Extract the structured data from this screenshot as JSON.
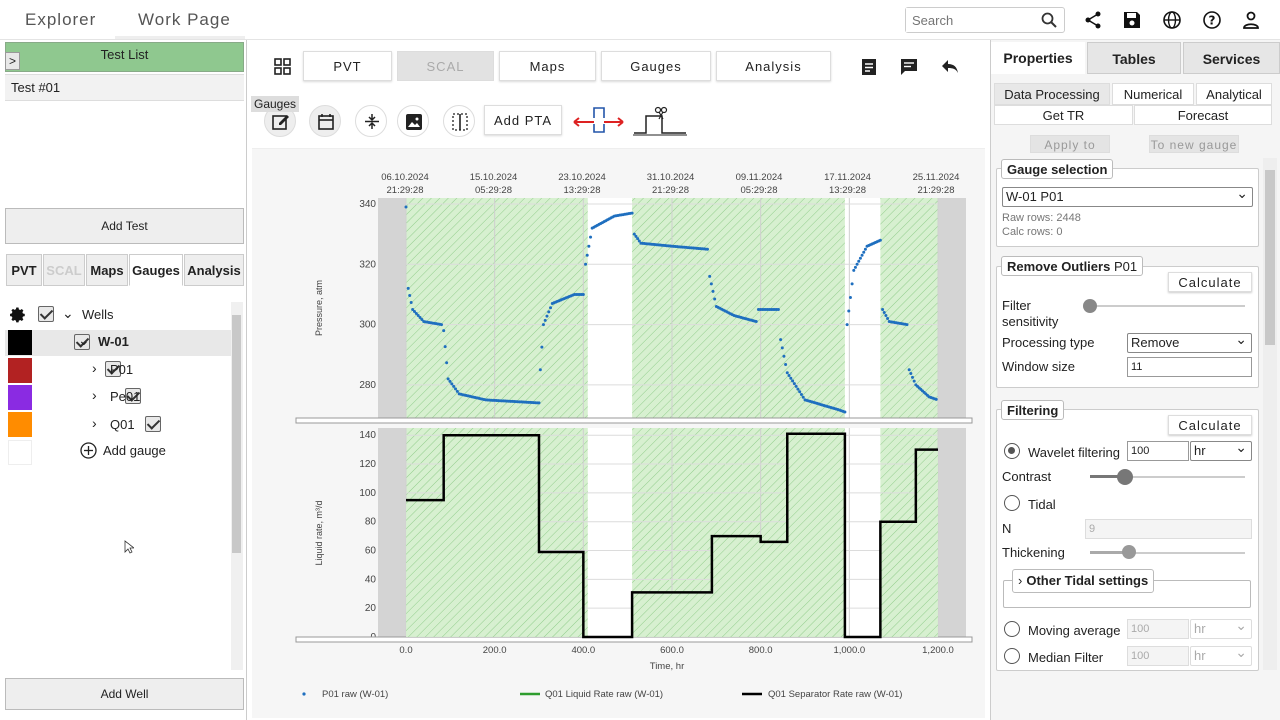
{
  "nav": {
    "explorer": "Explorer",
    "work_page": "Work Page"
  },
  "search": {
    "placeholder": "Search"
  },
  "top_icons": [
    "share-icon",
    "save-icon",
    "globe-icon",
    "help-icon",
    "user-icon"
  ],
  "left": {
    "test_list_header": "Test List",
    "collapse": ">",
    "test_item": "Test #01",
    "add_test": "Add Test",
    "tabs": [
      "PVT",
      "SCAL",
      "Maps",
      "Gauges",
      "Analysis"
    ],
    "tree": {
      "wells_label": "Wells",
      "well": "W-01",
      "gauges": [
        "P01",
        "Pe01",
        "Q01"
      ],
      "add_gauge": "Add gauge"
    },
    "swatch_colors": [
      "#000000",
      "#b22222",
      "#8a2be2",
      "#ff8c00",
      "#ffffff"
    ],
    "add_well": "Add Well"
  },
  "center": {
    "tabs": [
      "PVT",
      "SCAL",
      "Maps",
      "Gauges",
      "Analysis"
    ],
    "tooltip": "Gauges",
    "add_pta": "Add PTA"
  },
  "chart_data": {
    "type": "line",
    "top_axis_dates": [
      [
        "06.10.2024",
        "21:29:28"
      ],
      [
        "15.10.2024",
        "05:29:28"
      ],
      [
        "23.10.2024",
        "13:29:28"
      ],
      [
        "31.10.2024",
        "21:29:28"
      ],
      [
        "09.11.2024",
        "05:29:28"
      ],
      [
        "17.11.2024",
        "13:29:28"
      ],
      [
        "25.11.2024",
        "21:29:28"
      ]
    ],
    "xlabel": "Time, hr",
    "xticks": [
      "0.0",
      "200.0",
      "400.0",
      "600.0",
      "800.0",
      "1,000.0",
      "1,200.0"
    ],
    "xlim": [
      0,
      1200
    ],
    "pressure": {
      "ylabel": "Pressure, atm",
      "ylim": [
        269,
        342
      ],
      "yticks": [
        280,
        300,
        320,
        340
      ],
      "series_name": "P01 raw (W-01)",
      "points": [
        [
          0,
          339
        ],
        [
          5,
          312
        ],
        [
          15,
          305
        ],
        [
          40,
          301
        ],
        [
          80,
          300
        ],
        [
          85,
          298
        ],
        [
          95,
          282
        ],
        [
          120,
          277
        ],
        [
          180,
          275
        ],
        [
          300,
          274
        ],
        [
          303,
          285
        ],
        [
          310,
          300
        ],
        [
          330,
          307
        ],
        [
          380,
          310
        ],
        [
          400,
          310
        ],
        [
          405,
          320
        ],
        [
          420,
          332
        ],
        [
          470,
          336
        ],
        [
          510,
          337
        ],
        [
          515,
          330
        ],
        [
          530,
          327
        ],
        [
          600,
          326
        ],
        [
          680,
          325
        ],
        [
          685,
          316
        ],
        [
          700,
          306
        ],
        [
          740,
          303
        ],
        [
          790,
          301
        ],
        [
          795,
          305
        ],
        [
          820,
          305
        ],
        [
          840,
          305
        ],
        [
          845,
          295
        ],
        [
          860,
          284
        ],
        [
          900,
          275
        ],
        [
          970,
          272
        ],
        [
          990,
          271
        ],
        [
          995,
          300
        ],
        [
          1010,
          318
        ],
        [
          1040,
          326
        ],
        [
          1070,
          328
        ],
        [
          1075,
          305
        ],
        [
          1090,
          301
        ],
        [
          1130,
          300
        ],
        [
          1135,
          285
        ],
        [
          1150,
          280
        ],
        [
          1180,
          276
        ],
        [
          1200,
          275
        ]
      ]
    },
    "rate": {
      "ylabel": "Liquid rate, m³/d",
      "ylim": [
        0,
        145
      ],
      "yticks": [
        0,
        20,
        40,
        60,
        80,
        100,
        120,
        140
      ],
      "series_name": "Q01 Separator Rate raw (W-01)",
      "fill_name": "Q01 Liquid Rate raw (W-01)",
      "steps": [
        [
          0,
          95
        ],
        [
          85,
          140
        ],
        [
          300,
          59
        ],
        [
          400,
          0
        ],
        [
          510,
          31
        ],
        [
          690,
          70
        ],
        [
          800,
          66
        ],
        [
          860,
          141
        ],
        [
          990,
          0
        ],
        [
          1070,
          80
        ],
        [
          1150,
          130
        ],
        [
          1200,
          130
        ]
      ]
    },
    "legend": [
      "P01 raw (W-01)",
      "Q01 Liquid Rate raw (W-01)",
      "Q01 Separator Rate raw (W-01)"
    ],
    "legend_colors": [
      "#1f6fbf",
      "#2e9d2e",
      "#000000"
    ],
    "shaded_intervals": [
      [
        0,
        410
      ],
      [
        510,
        990
      ],
      [
        1070,
        1200
      ]
    ],
    "grid": true
  },
  "right": {
    "tabs": [
      "Properties",
      "Tables",
      "Services"
    ],
    "subtabs": [
      "Data Processing",
      "Numerical",
      "Analytical"
    ],
    "subtabs2": [
      "Get TR",
      "Forecast"
    ],
    "apply_raw": "Apply to raw",
    "to_new_gauge": "To new gauge",
    "gauge_selection": {
      "title": "Gauge selection",
      "selected": "W-01 P01",
      "raw_rows": "Raw rows: 2448",
      "calc_rows": "Calc rows: 0"
    },
    "outliers": {
      "title_bold": "Remove Outliers",
      "title_rest": " P01",
      "calculate": "Calculate",
      "filter_label1": "Filter",
      "filter_label2": "sensitivity",
      "processing_type_label": "Processing type",
      "processing_type": "Remove",
      "window_label": "Window size",
      "window_value": "11"
    },
    "filtering": {
      "title": "Filtering",
      "calculate": "Calculate",
      "wavelet_label": "Wavelet filtering",
      "wavelet_value": "100",
      "wavelet_unit": "hr",
      "contrast_label": "Contrast",
      "tidal_label": "Tidal",
      "n_label": "N",
      "n_value": "9",
      "thickening_label": "Thickening",
      "other_tidal": "Other Tidal settings",
      "moving_avg_label": "Moving average",
      "moving_avg_value": "100",
      "moving_avg_unit": "hr",
      "median_label": "Median Filter",
      "median_value": "100",
      "median_unit": "hr"
    }
  }
}
